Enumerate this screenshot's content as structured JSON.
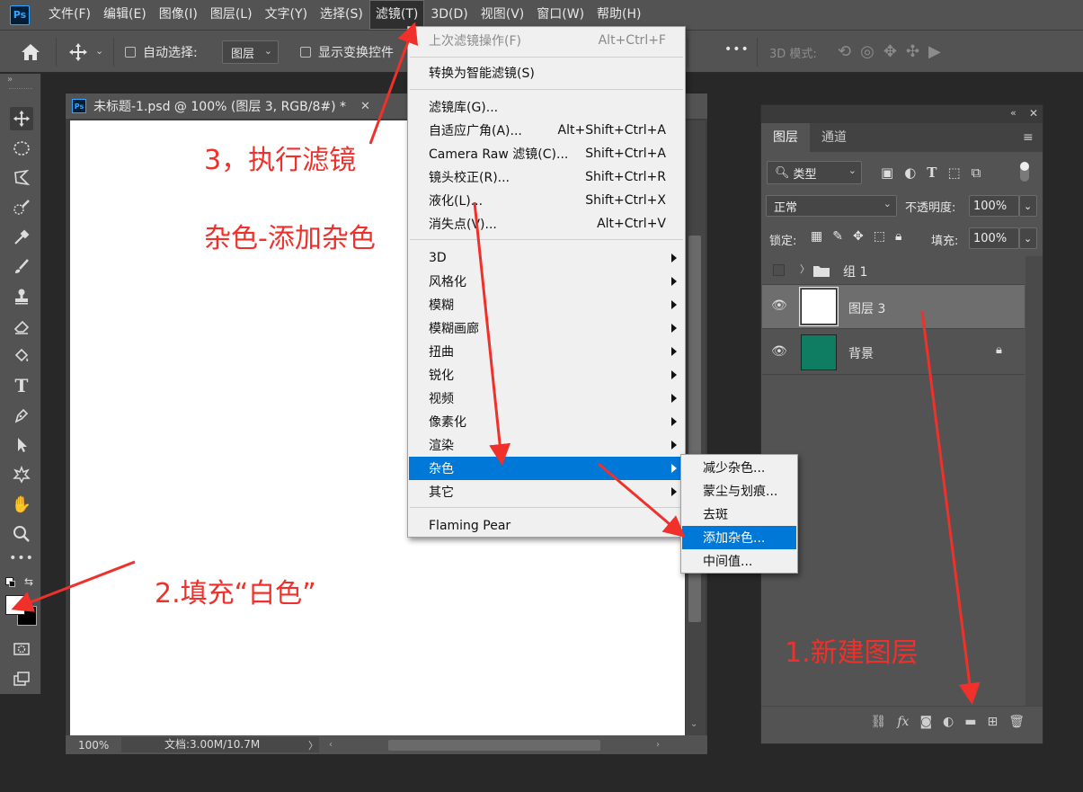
{
  "app": {
    "logo_text": "Ps"
  },
  "menubar": {
    "items": [
      "文件(F)",
      "编辑(E)",
      "图像(I)",
      "图层(L)",
      "文字(Y)",
      "选择(S)",
      "滤镜(T)",
      "3D(D)",
      "视图(V)",
      "窗口(W)",
      "帮助(H)"
    ],
    "active_index": 6
  },
  "options": {
    "auto_select_label": "自动选择:",
    "auto_select_value": "图层",
    "show_transform_label": "显示变换控件",
    "more": "•••",
    "mode_3d_label": "3D 模式:"
  },
  "document": {
    "tab_title": "未标题-1.psd @ 100% (图层 3, RGB/8#) *",
    "zoom": "100%",
    "doc_info": "文档:3.00M/10.7M"
  },
  "filter_menu": {
    "last_filter": {
      "label": "上次滤镜操作(F)",
      "shortcut": "Alt+Ctrl+F"
    },
    "smart": {
      "label": "转换为智能滤镜(S)"
    },
    "group2": [
      {
        "label": "滤镜库(G)...",
        "shortcut": ""
      },
      {
        "label": "自适应广角(A)...",
        "shortcut": "Alt+Shift+Ctrl+A"
      },
      {
        "label": "Camera Raw 滤镜(C)...",
        "shortcut": "Shift+Ctrl+A"
      },
      {
        "label": "镜头校正(R)...",
        "shortcut": "Shift+Ctrl+R"
      },
      {
        "label": "液化(L)...",
        "shortcut": "Shift+Ctrl+X"
      },
      {
        "label": "消失点(V)...",
        "shortcut": "Alt+Ctrl+V"
      }
    ],
    "submenus": [
      "3D",
      "风格化",
      "模糊",
      "模糊画廊",
      "扭曲",
      "锐化",
      "视频",
      "像素化",
      "渲染",
      "杂色",
      "其它"
    ],
    "highlighted_submenu_index": 9,
    "plugin": "Flaming Pear"
  },
  "noise_submenu": {
    "items": [
      "减少杂色...",
      "蒙尘与划痕...",
      "去斑",
      "添加杂色...",
      "中间值..."
    ],
    "highlighted_index": 3
  },
  "layers_panel": {
    "tabs": [
      "图层",
      "通道"
    ],
    "filter_label": "类型",
    "blend_mode": "正常",
    "opacity_label": "不透明度:",
    "opacity_value": "100%",
    "lock_label": "锁定:",
    "fill_label": "填充:",
    "fill_value": "100%",
    "layers": [
      {
        "name": "组 1",
        "type": "group",
        "thumb_color": ""
      },
      {
        "name": "图层 3",
        "type": "layer",
        "thumb_color": "#ffffff"
      },
      {
        "name": "背景",
        "type": "background",
        "thumb_color": "#0f7d62"
      }
    ]
  },
  "annotations": {
    "step3": "3，执行滤镜",
    "noise_path": "杂色-添加杂色",
    "step2": "2.填充“白色”",
    "step1": "1.新建图层"
  },
  "colors": {
    "annotation": "#f0302a",
    "highlight": "#0078d7",
    "background_layer": "#0f7d62"
  }
}
